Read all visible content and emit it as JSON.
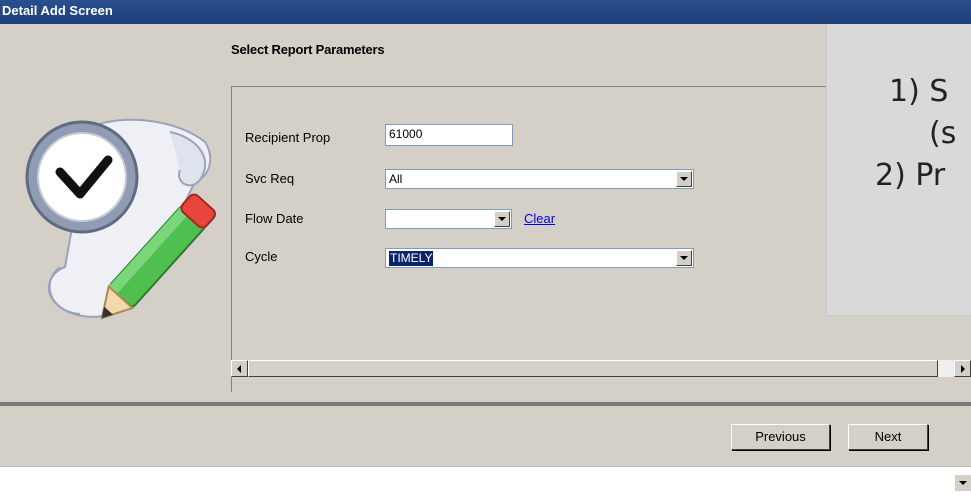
{
  "window": {
    "title": "Detail Add Screen"
  },
  "section": {
    "title": "Select Report Parameters"
  },
  "form": {
    "recipient_prop": {
      "label": "Recipient Prop",
      "value": "61000"
    },
    "svc_req": {
      "label": "Svc Req",
      "value": "All"
    },
    "flow_date": {
      "label": "Flow Date",
      "value": "",
      "clear_link": "Clear"
    },
    "cycle": {
      "label": "Cycle",
      "value": "TIMELY"
    }
  },
  "buttons": {
    "previous": "Previous",
    "next": "Next"
  },
  "overlay": {
    "line1": "1)   S",
    "line2": "(s",
    "line3": "2) Pr"
  },
  "colors": {
    "titlebar": "#1f3f78",
    "selection": "#0a246a",
    "link": "#0000ee"
  }
}
